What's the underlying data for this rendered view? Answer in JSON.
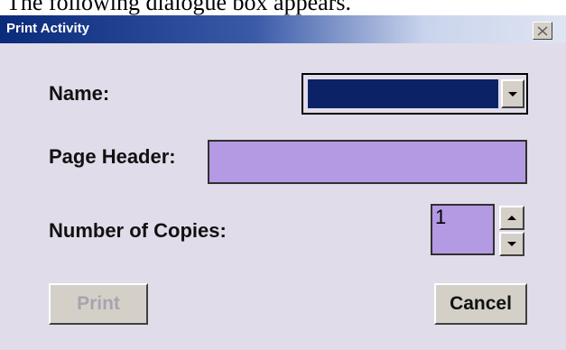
{
  "caption": "The following dialogue box appears.",
  "dialog": {
    "title": "Print Activity",
    "close_glyph": "×",
    "name_label": "Name:",
    "name_value": "",
    "page_header_label": "Page Header:",
    "page_header_value": "",
    "copies_label": "Number of Copies:",
    "copies_value": "1",
    "print_label": "Print",
    "cancel_label": "Cancel"
  },
  "colors": {
    "title_bar": "#0a2a7a",
    "name_field": "#0b2266",
    "input_fill": "#b39ae3",
    "dialog_bg": "#e0dce9"
  },
  "icons": [
    "close-icon",
    "chevron-down-icon",
    "chevron-up-icon"
  ]
}
